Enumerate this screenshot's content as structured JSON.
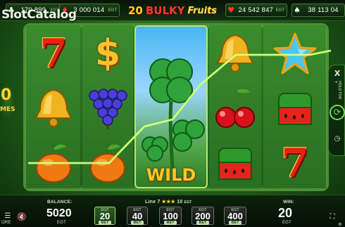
{
  "watermark": "SlotCatalog",
  "title": {
    "num": "20",
    "bulky": "BULKY",
    "fruits": "Fruits"
  },
  "jackpots": [
    {
      "symbol": "club",
      "glyph": "♣",
      "color": "#ffffff",
      "amount": "170 899",
      "currency": "EGT"
    },
    {
      "symbol": "diamond",
      "glyph": "♦",
      "color": "#ff3a2c",
      "amount": "3 000 014",
      "currency": "EGT"
    },
    {
      "symbol": "heart",
      "glyph": "♥",
      "color": "#ff3a2c",
      "amount": "24 542 847",
      "currency": "EGT"
    },
    {
      "symbol": "spade",
      "glyph": "♠",
      "color": "#ffffff",
      "amount": "38 113 04",
      "currency": ""
    }
  ],
  "wild_label": "WILD",
  "left_panel": {
    "value": "0",
    "label": "MES"
  },
  "right_panel": {
    "close_glyph": "X",
    "hold_label": "HOLD FOR T"
  },
  "reels": {
    "r1": [
      "seven",
      "bell",
      "orange"
    ],
    "r2": [
      "dollar",
      "grapes",
      "orange"
    ],
    "r4": [
      "bell",
      "cherries",
      "watermelon"
    ],
    "r5": [
      "star",
      "watermelon",
      "seven"
    ]
  },
  "bottom": {
    "balance_label": "BALANCE:",
    "balance_value": "5020",
    "balance_currency": "EGT",
    "line_label": "Line 7",
    "line_stars": "★★★",
    "line_value": "10",
    "line_currency": "EGT",
    "win_label": "WIN:",
    "win_value": "20",
    "win_currency": "EGT",
    "more_label": "ORE",
    "bets": [
      {
        "currency": "EGT",
        "value": "20",
        "tag": "BET",
        "active": true
      },
      {
        "currency": "EGT",
        "value": "40",
        "tag": "BET",
        "active": false
      },
      {
        "currency": "EGT",
        "value": "100",
        "tag": "BET",
        "active": false
      },
      {
        "currency": "EGT",
        "value": "200",
        "tag": "BET",
        "active": false
      },
      {
        "currency": "EGT",
        "value": "400",
        "tag": "BET",
        "active": false
      }
    ]
  },
  "colors": {
    "accent": "#ffc72a",
    "win_line": "#b6ff3a",
    "frame": "#4e8f34"
  }
}
